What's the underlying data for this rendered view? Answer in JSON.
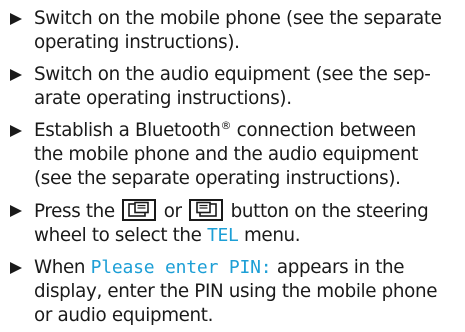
{
  "steps": [
    {
      "lines": [
        "Switch on the mobile phone (see the separate",
        "operating instructions)."
      ]
    },
    {
      "lines": [
        "Switch on the audio equipment (see the sep-",
        "arate operating instructions)."
      ]
    },
    {
      "line1_pre": "Establish a Bluetooth",
      "line1_sup": "®",
      "line1_post": " connection between",
      "lines_rest": [
        "the mobile phone and the audio equipment",
        "(see the separate operating instructions)."
      ]
    },
    {
      "line1_pre": "Press the ",
      "line1_or": " or ",
      "line1_post": " button on the steering",
      "line2_pre": "wheel to select the ",
      "line2_menu": "TEL",
      "line2_post": " menu.",
      "icons": [
        "phone-back-button-icon",
        "phone-forward-button-icon"
      ]
    },
    {
      "line1_pre": "When ",
      "line1_display": "Please enter PIN:",
      "line1_post": " appears in the",
      "lines_rest": [
        "display, enter the PIN using the mobile phone",
        "or audio equipment."
      ]
    }
  ],
  "colors": {
    "text": "#1a1a1a",
    "display_text": "#1d9fd6"
  }
}
